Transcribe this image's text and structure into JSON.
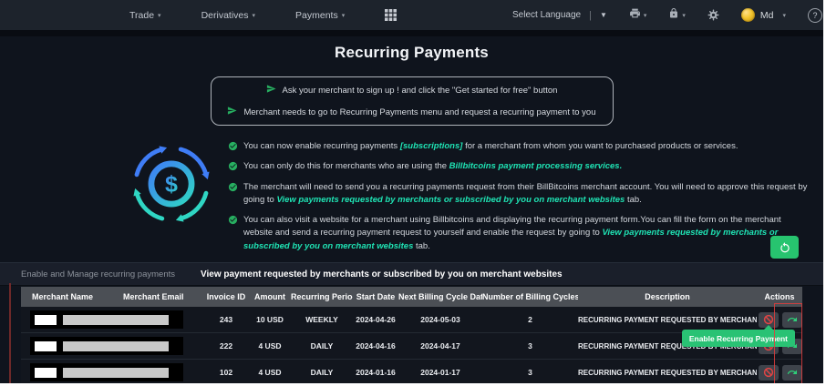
{
  "navbar": {
    "items": [
      {
        "label": "Trade"
      },
      {
        "label": "Derivatives"
      },
      {
        "label": "Payments"
      }
    ],
    "language_label": "Select Language",
    "user_label": "Md"
  },
  "glyphs": {
    "caret": "▾",
    "caret_down": "▼",
    "divider": "|",
    "help": "?"
  },
  "page": {
    "title": "Recurring Payments",
    "intro_lines": [
      "Ask your merchant to sign up ! and click the \"Get started for free\" button",
      "Merchant needs to go to Recurring Payments menu and request a recurring payment to you"
    ],
    "bullets": [
      {
        "pre": "You can now enable recurring payments ",
        "em": "[subscriptions]",
        "post": " for a merchant from whom you want to purchased products or services."
      },
      {
        "pre": "You can only do this for merchants who are using the ",
        "em": "Billbitcoins payment processing services.",
        "post": ""
      },
      {
        "pre": "The merchant will need to send you a recurring payments request from their BillBitcoins merchant account. You will need to approve this request by going to ",
        "em": "View payments requested by merchants or subscribed by you on merchant websites",
        "post": " tab."
      },
      {
        "pre": "You can also visit a website for a merchant using Billbitcoins and displaying the recurring payment form.You can fill the form on the merchant website and send a recurring payment request to yourself and enable the request by going to ",
        "em": "View payments requested by merchants or subscribed by you on merchant websites",
        "post": " tab."
      }
    ]
  },
  "tabs": [
    {
      "label": "Enable and Manage recurring payments",
      "active": false
    },
    {
      "label": "View payment requested by merchants or subscribed by you on merchant websites",
      "active": true
    }
  ],
  "table": {
    "headers": [
      "Merchant Name",
      "Merchant Email",
      "Invoice ID",
      "Amount",
      "Recurring Period",
      "Start Date",
      "Next Billing Cycle Date",
      "Number of Billing Cycles",
      "Description",
      "Actions"
    ],
    "rows": [
      {
        "invoice_id": "243",
        "amount": "10 USD",
        "recurring_period": "WEEKLY",
        "start_date": "2024-04-26",
        "next_billing_cycle_date": "2024-05-03",
        "number_of_billing_cycles": "2",
        "description": "RECURRING PAYMENT REQUESTED BY MERCHANT"
      },
      {
        "invoice_id": "222",
        "amount": "4 USD",
        "recurring_period": "DAILY",
        "start_date": "2024-04-16",
        "next_billing_cycle_date": "2024-04-17",
        "number_of_billing_cycles": "3",
        "description": "RECURRING PAYMENT REQUESTED BY MERCHANT"
      },
      {
        "invoice_id": "102",
        "amount": "4 USD",
        "recurring_period": "DAILY",
        "start_date": "2024-01-16",
        "next_billing_cycle_date": "2024-01-17",
        "number_of_billing_cycles": "3",
        "description": "RECURRING PAYMENT REQUESTED BY MERCHANT"
      }
    ]
  },
  "tooltip": {
    "label": "Enable Recurring Payment"
  },
  "colors": {
    "accent_green": "#27c46f",
    "teal_link": "#1fe3b4",
    "nav_bg": "#1d232c",
    "main_bg": "#0f141d",
    "table_header_bg": "#4b4f55"
  }
}
